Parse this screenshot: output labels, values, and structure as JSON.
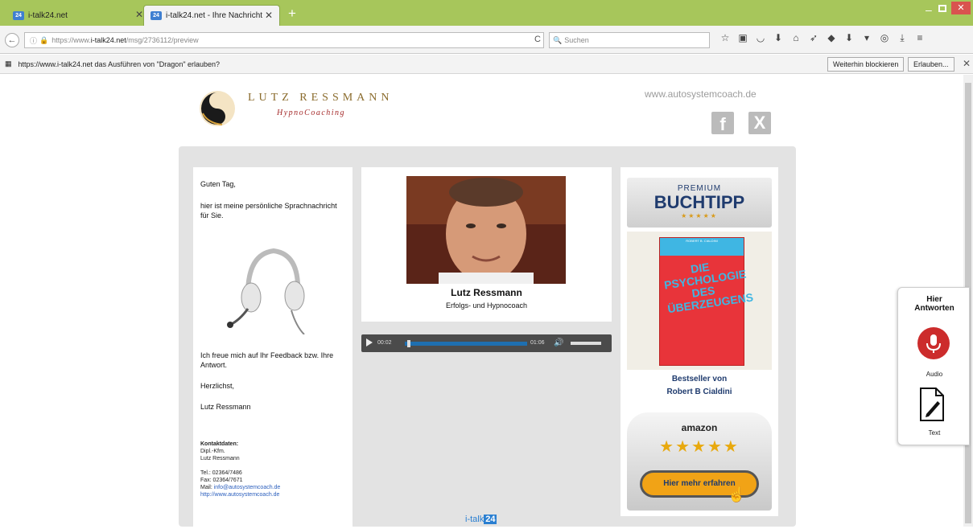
{
  "browser": {
    "tabs": [
      {
        "label": "i-talk24.net",
        "active": false,
        "favicon": "24"
      },
      {
        "label": "i-talk24.net - Ihre Nachricht",
        "active": true,
        "favicon": "24"
      }
    ],
    "new_tab_icon": "plus-icon",
    "url": {
      "prefix": "https://www.",
      "domain": "i-talk24.net",
      "path": "/msg/2736112/preview"
    },
    "search_placeholder": "Suchen",
    "notification": {
      "text": "https://www.i-talk24.net das Ausführen von \"Dragon\" erlauben?",
      "block_label": "Weiterhin blockieren",
      "allow_label": "Erlauben..."
    }
  },
  "header": {
    "brand_name": "LUTZ RESSMANN",
    "brand_sub": "HypnoCoaching",
    "site_url": "www.autosystemcoach.de",
    "facebook_glyph": "f",
    "xing_glyph": "X"
  },
  "message": {
    "greeting": "Guten Tag,",
    "intro": "hier ist meine persönliche Sprachnachricht für Sie.",
    "feedback": "Ich freue mich auf Ihr Feedback bzw. Ihre Antwort.",
    "closing": "Herzlichst,",
    "signature": "Lutz Ressmann"
  },
  "contact": {
    "heading": "Kontaktdaten:",
    "title": "Dipl.-Kfm.",
    "name": "Lutz Ressmann",
    "tel": "Tel.: 02364/7486",
    "fax": "Fax: 02364/7671",
    "mail_label": "Mail:",
    "mail": "info@autosystemcoach.de",
    "web": "http://www.autosystemcoach.de"
  },
  "profile": {
    "name": "Lutz Ressmann",
    "role": "Erfolgs- und Hypnocoach"
  },
  "player": {
    "current_time": "00:02",
    "duration": "01:06",
    "progress": 0.03
  },
  "footer": {
    "brand": "i-talk",
    "brand_badge": "24"
  },
  "ad": {
    "premium_top": "PREMIUM",
    "premium_main": "BUCHTIPP",
    "premium_stars": "★★★★★",
    "book_author": "ROBERT B. CIALDINI",
    "book_title": "DIE PSYCHOLOGIE DES ÜBERZEUGENS",
    "bestseller_line1": "Bestseller von",
    "bestseller_line2": "Robert B Cialdini",
    "amazon": "amazon",
    "rating": 4.5,
    "stars": "★★★★★",
    "cta": "Hier mehr erfahren"
  },
  "answer_panel": {
    "heading_line1": "Hier",
    "heading_line2": "Antworten",
    "audio_label": "Audio",
    "text_label": "Text"
  },
  "colors": {
    "tabbar": "#a7c65b",
    "brand_gold": "#8a6b2c",
    "brand_red": "#a52a2a",
    "link_blue": "#2a5ebd",
    "ad_navy": "#1f3b6e",
    "cta_orange": "#f1a316",
    "mic_red": "#cc2c2c"
  }
}
